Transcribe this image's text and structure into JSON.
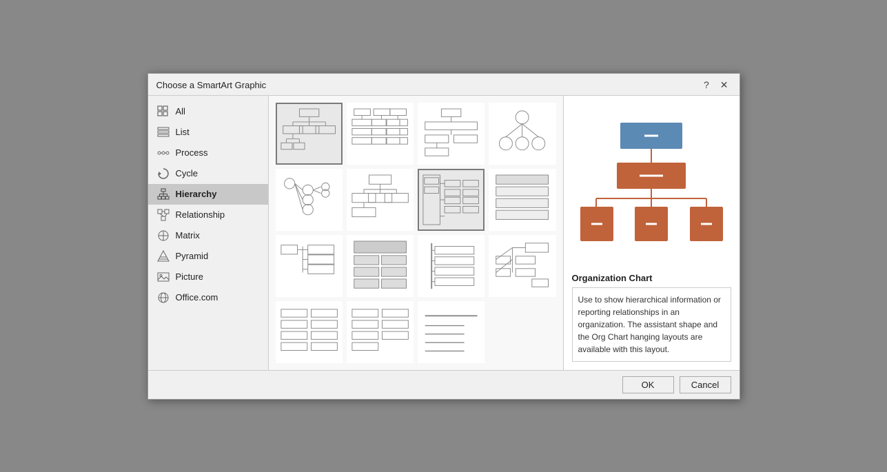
{
  "dialog": {
    "title": "Choose a SmartArt Graphic",
    "help_label": "?",
    "close_label": "✕"
  },
  "sidebar": {
    "items": [
      {
        "id": "all",
        "label": "All",
        "icon": "grid-icon"
      },
      {
        "id": "list",
        "label": "List",
        "icon": "list-icon"
      },
      {
        "id": "process",
        "label": "Process",
        "icon": "process-icon"
      },
      {
        "id": "cycle",
        "label": "Cycle",
        "icon": "cycle-icon"
      },
      {
        "id": "hierarchy",
        "label": "Hierarchy",
        "icon": "hierarchy-icon",
        "active": true
      },
      {
        "id": "relationship",
        "label": "Relationship",
        "icon": "relationship-icon"
      },
      {
        "id": "matrix",
        "label": "Matrix",
        "icon": "matrix-icon"
      },
      {
        "id": "pyramid",
        "label": "Pyramid",
        "icon": "pyramid-icon"
      },
      {
        "id": "picture",
        "label": "Picture",
        "icon": "picture-icon"
      },
      {
        "id": "office",
        "label": "Office.com",
        "icon": "office-icon"
      }
    ]
  },
  "preview": {
    "title": "Organization Chart",
    "description": "Use to show hierarchical information or reporting relationships in an organization. The assistant shape and the Org Chart hanging layouts are available with this layout."
  },
  "footer": {
    "ok_label": "OK",
    "cancel_label": "Cancel"
  },
  "colors": {
    "blue": "#5b8ab5",
    "orange": "#c0623a",
    "selected_border": "#7a7a7a"
  }
}
